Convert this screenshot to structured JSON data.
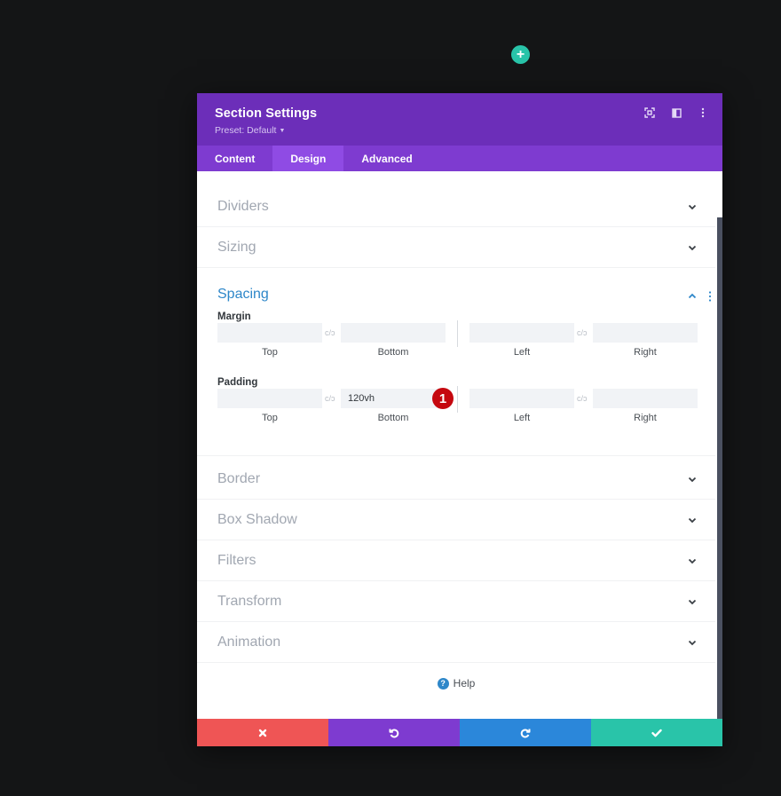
{
  "canvas": {
    "add_section_label": "+"
  },
  "header": {
    "title": "Section Settings",
    "preset": "Preset: Default",
    "icons": [
      "fullscreen-icon",
      "split-view-icon",
      "more-options-icon"
    ]
  },
  "tabs": [
    {
      "label": "Content",
      "active": false
    },
    {
      "label": "Design",
      "active": true
    },
    {
      "label": "Advanced",
      "active": false
    }
  ],
  "toggles_above": [
    {
      "label": "Dividers"
    },
    {
      "label": "Sizing"
    }
  ],
  "spacing": {
    "title": "Spacing",
    "margin": {
      "label": "Margin",
      "top": {
        "value": "",
        "label": "Top"
      },
      "bottom": {
        "value": "",
        "label": "Bottom"
      },
      "left": {
        "value": "",
        "label": "Left"
      },
      "right": {
        "value": "",
        "label": "Right"
      }
    },
    "padding": {
      "label": "Padding",
      "top": {
        "value": "",
        "label": "Top"
      },
      "bottom": {
        "value": "120vh",
        "label": "Bottom"
      },
      "left": {
        "value": "",
        "label": "Left"
      },
      "right": {
        "value": "",
        "label": "Right"
      }
    },
    "link_glyph": "c/ɔ",
    "annotation_badge": "1"
  },
  "toggles_below": [
    {
      "label": "Border"
    },
    {
      "label": "Box Shadow"
    },
    {
      "label": "Filters"
    },
    {
      "label": "Transform"
    },
    {
      "label": "Animation"
    }
  ],
  "help": {
    "icon": "?",
    "label": "Help"
  },
  "footer": {
    "buttons": [
      {
        "name": "cancel",
        "icon": "close-icon",
        "color": "#ef5555"
      },
      {
        "name": "undo",
        "icon": "undo-icon",
        "color": "#7e3bd0"
      },
      {
        "name": "redo",
        "icon": "redo-icon",
        "color": "#2b87da"
      },
      {
        "name": "save",
        "icon": "check-icon",
        "color": "#29c4a9"
      }
    ]
  },
  "colors": {
    "header": "#6c2eb9",
    "tabs": "#7e3bd0",
    "tab_active": "#8f4be4",
    "accent_blue": "#2e87c9",
    "badge": "#c5080f"
  }
}
